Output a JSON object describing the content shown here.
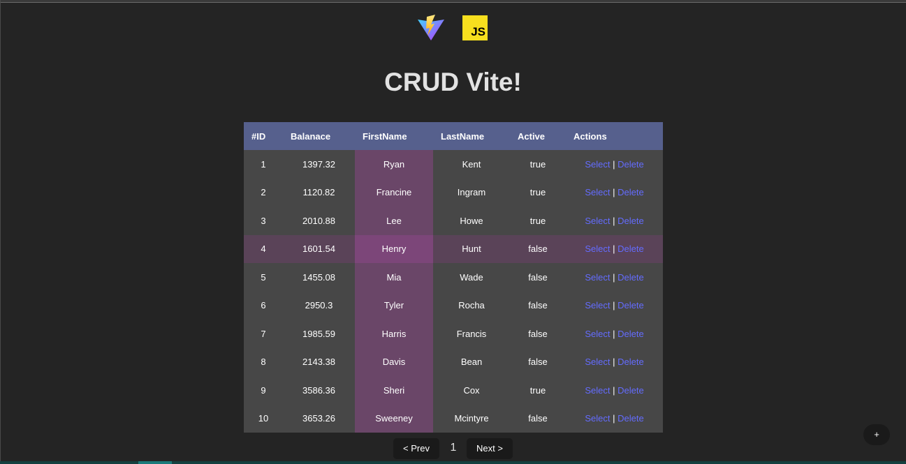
{
  "app": {
    "title": "CRUD Vite!"
  },
  "logos": {
    "vite": "vite-logo",
    "js": "JS"
  },
  "table": {
    "headers": [
      "#ID",
      "Balanace",
      "FirstName",
      "LastName",
      "Active",
      "Actions"
    ],
    "rows": [
      {
        "id": "1",
        "balance": "1397.32",
        "first": "Ryan",
        "last": "Kent",
        "active": "true"
      },
      {
        "id": "2",
        "balance": "1120.82",
        "first": "Francine",
        "last": "Ingram",
        "active": "true"
      },
      {
        "id": "3",
        "balance": "2010.88",
        "first": "Lee",
        "last": "Howe",
        "active": "true"
      },
      {
        "id": "4",
        "balance": "1601.54",
        "first": "Henry",
        "last": "Hunt",
        "active": "false"
      },
      {
        "id": "5",
        "balance": "1455.08",
        "first": "Mia",
        "last": "Wade",
        "active": "false"
      },
      {
        "id": "6",
        "balance": "2950.3",
        "first": "Tyler",
        "last": "Rocha",
        "active": "false"
      },
      {
        "id": "7",
        "balance": "1985.59",
        "first": "Harris",
        "last": "Francis",
        "active": "false"
      },
      {
        "id": "8",
        "balance": "2143.38",
        "first": "Davis",
        "last": "Bean",
        "active": "false"
      },
      {
        "id": "9",
        "balance": "3586.36",
        "first": "Sheri",
        "last": "Cox",
        "active": "true"
      },
      {
        "id": "10",
        "balance": "3653.26",
        "first": "Sweeney",
        "last": "Mcintyre",
        "active": "false"
      }
    ],
    "actions": {
      "select": "Select",
      "separator": "|",
      "delete": "Delete"
    }
  },
  "pagination": {
    "prev": "< Prev",
    "page": "1",
    "next": "Next >"
  },
  "fab": {
    "label": "+"
  },
  "colors": {
    "background": "#242424",
    "header": "#56608d",
    "row": "#474747",
    "row_highlight": "#5a4358",
    "column_highlight": "#6a4668",
    "link": "#646cff"
  }
}
